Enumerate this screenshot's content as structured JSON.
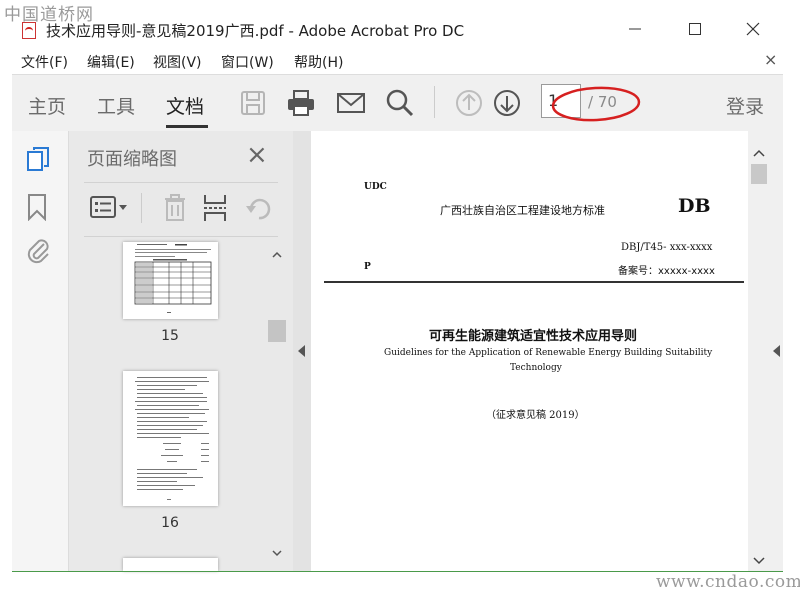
{
  "watermark_top": "中国道桥网",
  "watermark_bottom": "www.cndao.com",
  "window": {
    "title": "技术应用导则-意见稿2019广西.pdf - Adobe Acrobat Pro DC"
  },
  "menu": {
    "items": [
      "文件(F)",
      "编辑(E)",
      "视图(V)",
      "窗口(W)",
      "帮助(H)"
    ],
    "close": "×"
  },
  "toolbar": {
    "tabs": [
      "主页",
      "工具",
      "文档"
    ],
    "active_tab": "文档",
    "page_current": "1",
    "page_total": "/ 70",
    "login": "登录",
    "highlight_color": "#d62020"
  },
  "panel": {
    "title": "页面缩略图",
    "close": "×",
    "thumbnails": [
      {
        "label": "15"
      },
      {
        "label": "16"
      }
    ]
  },
  "document": {
    "udc": "UDC",
    "header_center": "广西壮族自治区工程建设地方标准",
    "db": "DB",
    "code": "DBJ/T45- xxx-xxxx",
    "p": "P",
    "record_no": "备案号：xxxxx-xxxx",
    "title_cn": "可再生能源建筑适宜性技术应用导则",
    "title_en_line1": "Guidelines for the Application of Renewable Energy Building Suitability",
    "title_en_line2": "Technology",
    "draft_note": "（征求意见稿 2019）"
  }
}
